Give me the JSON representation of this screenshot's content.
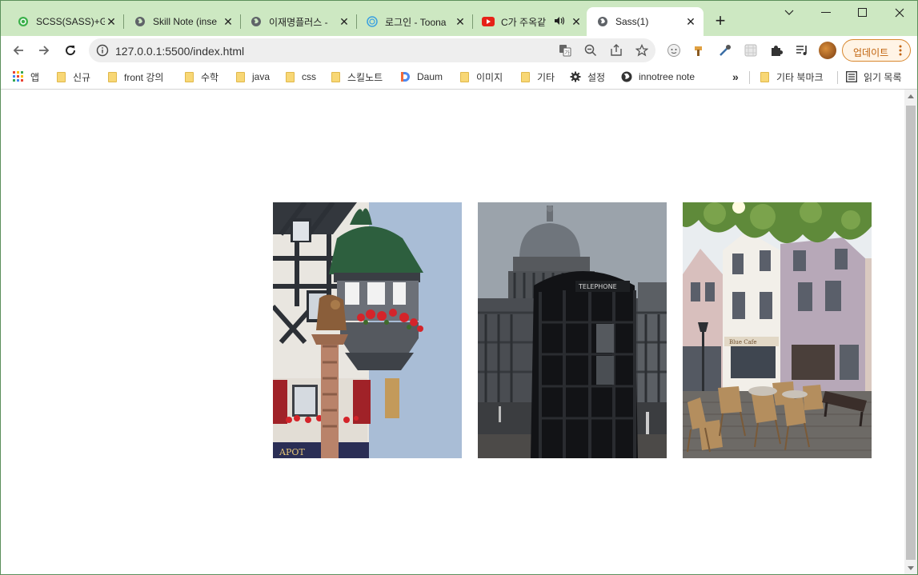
{
  "tabs": [
    {
      "title": "SCSS(SASS)+Gi",
      "favicon": "scss-favicon-icon",
      "active": false
    },
    {
      "title": "Skill Note (inse",
      "favicon": "globe-icon",
      "active": false
    },
    {
      "title": "이재명플러스 -",
      "favicon": "globe-icon",
      "active": false
    },
    {
      "title": "로그인 - Toona",
      "favicon": "toonation-icon",
      "active": false
    },
    {
      "title": "C가 주옥같",
      "favicon": "youtube-icon",
      "active": false,
      "audio": true
    },
    {
      "title": "Sass(1)",
      "favicon": "globe-icon",
      "active": true
    }
  ],
  "toolbar": {
    "url": "127.0.0.1:5500/index.html",
    "update_label": "업데이트"
  },
  "bookmarks": {
    "items": [
      {
        "label": "앱",
        "icon": "apps-grid-icon"
      },
      {
        "label": "신규",
        "icon": "folder-icon"
      },
      {
        "label": "front 강의",
        "icon": "folder-icon"
      },
      {
        "label": "수학",
        "icon": "folder-icon"
      },
      {
        "label": "java",
        "icon": "folder-icon"
      },
      {
        "label": "css",
        "icon": "folder-icon"
      },
      {
        "label": "스킬노트",
        "icon": "folder-icon"
      },
      {
        "label": "Daum",
        "icon": "daum-icon"
      },
      {
        "label": "이미지",
        "icon": "folder-icon"
      },
      {
        "label": "기타",
        "icon": "folder-icon"
      },
      {
        "label": "설정",
        "icon": "settings-gear-icon"
      },
      {
        "label": "innotree note",
        "icon": "globe-icon"
      }
    ],
    "overflow": "»",
    "other_bookmarks": "기타 북마크",
    "reading_list": "읽기 목록"
  },
  "colors": {
    "tabstrip": "#cde8c2",
    "update_accent": "#d8872e"
  },
  "photos": [
    {
      "name": "half-timbered-house-photo"
    },
    {
      "name": "cathedral-telephone-box-photo"
    },
    {
      "name": "street-cafe-photo"
    }
  ]
}
